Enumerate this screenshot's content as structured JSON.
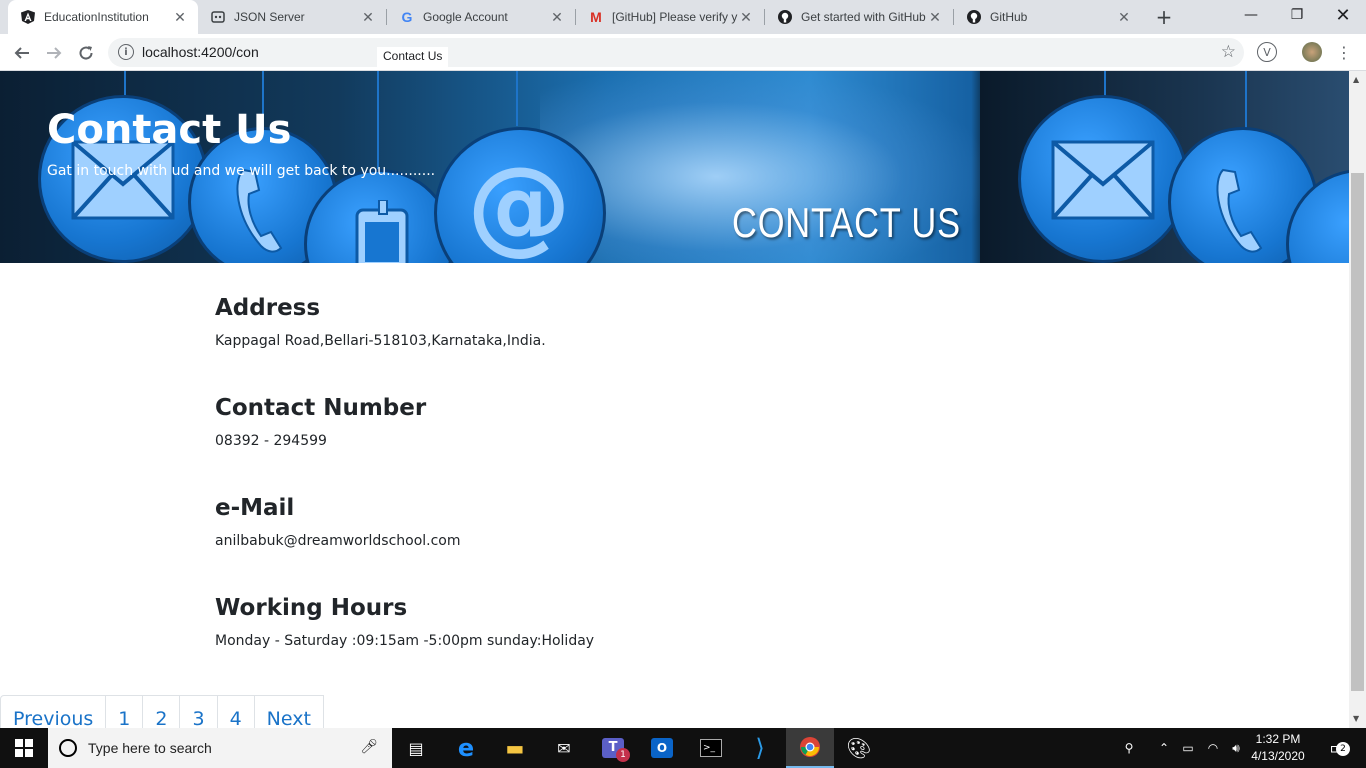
{
  "browser": {
    "tabs": [
      {
        "title": "EducationInstitution",
        "icon": "angular-icon",
        "active": true
      },
      {
        "title": "JSON Server",
        "icon": "json-server-icon",
        "active": false
      },
      {
        "title": "Google Account",
        "icon": "google-icon",
        "active": false
      },
      {
        "title": "[GitHub] Please verify y",
        "icon": "gmail-icon",
        "active": false
      },
      {
        "title": "Get started with GitHub",
        "icon": "github-icon",
        "active": false
      },
      {
        "title": "GitHub",
        "icon": "github-icon",
        "active": false
      }
    ],
    "url": "localhost:4200/con",
    "tooltip": "Contact Us"
  },
  "banner": {
    "title": "Contact Us",
    "subtitle": "Gat in touch with ud and we will get back to you...........",
    "image_text": "CONTACT US"
  },
  "sections": [
    {
      "heading": "Address",
      "text": "Kappagal Road,Bellari-518103,Karnataka,India."
    },
    {
      "heading": "Contact Number",
      "text": "08392 - 294599"
    },
    {
      "heading": "e-Mail",
      "text": "anilbabuk@dreamworldschool.com"
    },
    {
      "heading": "Working Hours",
      "text": "Monday - Saturday :09:15am -5:00pm sunday:Holiday"
    }
  ],
  "pagination": {
    "previous": "Previous",
    "pages": [
      "1",
      "2",
      "3",
      "4"
    ],
    "next": "Next"
  },
  "taskbar": {
    "search_placeholder": "Type here to search",
    "time": "1:32 PM",
    "date": "4/13/2020",
    "notification_count": "2",
    "teams_badge": "1"
  },
  "colors": {
    "link": "#1a73c8",
    "banner_blue": "#1776d1",
    "taskbar": "#101010"
  }
}
